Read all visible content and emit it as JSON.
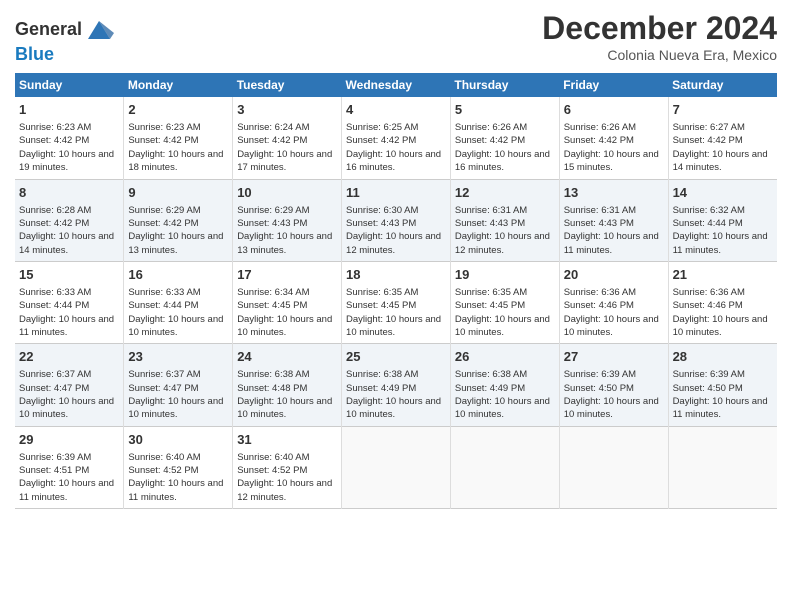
{
  "header": {
    "logo_line1": "General",
    "logo_line2": "Blue",
    "month": "December 2024",
    "location": "Colonia Nueva Era, Mexico"
  },
  "weekdays": [
    "Sunday",
    "Monday",
    "Tuesday",
    "Wednesday",
    "Thursday",
    "Friday",
    "Saturday"
  ],
  "weeks": [
    [
      {
        "day": "1",
        "sunrise": "6:23 AM",
        "sunset": "4:42 PM",
        "daylight": "10 hours and 19 minutes."
      },
      {
        "day": "2",
        "sunrise": "6:23 AM",
        "sunset": "4:42 PM",
        "daylight": "10 hours and 18 minutes."
      },
      {
        "day": "3",
        "sunrise": "6:24 AM",
        "sunset": "4:42 PM",
        "daylight": "10 hours and 17 minutes."
      },
      {
        "day": "4",
        "sunrise": "6:25 AM",
        "sunset": "4:42 PM",
        "daylight": "10 hours and 16 minutes."
      },
      {
        "day": "5",
        "sunrise": "6:26 AM",
        "sunset": "4:42 PM",
        "daylight": "10 hours and 16 minutes."
      },
      {
        "day": "6",
        "sunrise": "6:26 AM",
        "sunset": "4:42 PM",
        "daylight": "10 hours and 15 minutes."
      },
      {
        "day": "7",
        "sunrise": "6:27 AM",
        "sunset": "4:42 PM",
        "daylight": "10 hours and 14 minutes."
      }
    ],
    [
      {
        "day": "8",
        "sunrise": "6:28 AM",
        "sunset": "4:42 PM",
        "daylight": "10 hours and 14 minutes."
      },
      {
        "day": "9",
        "sunrise": "6:29 AM",
        "sunset": "4:42 PM",
        "daylight": "10 hours and 13 minutes."
      },
      {
        "day": "10",
        "sunrise": "6:29 AM",
        "sunset": "4:43 PM",
        "daylight": "10 hours and 13 minutes."
      },
      {
        "day": "11",
        "sunrise": "6:30 AM",
        "sunset": "4:43 PM",
        "daylight": "10 hours and 12 minutes."
      },
      {
        "day": "12",
        "sunrise": "6:31 AM",
        "sunset": "4:43 PM",
        "daylight": "10 hours and 12 minutes."
      },
      {
        "day": "13",
        "sunrise": "6:31 AM",
        "sunset": "4:43 PM",
        "daylight": "10 hours and 11 minutes."
      },
      {
        "day": "14",
        "sunrise": "6:32 AM",
        "sunset": "4:44 PM",
        "daylight": "10 hours and 11 minutes."
      }
    ],
    [
      {
        "day": "15",
        "sunrise": "6:33 AM",
        "sunset": "4:44 PM",
        "daylight": "10 hours and 11 minutes."
      },
      {
        "day": "16",
        "sunrise": "6:33 AM",
        "sunset": "4:44 PM",
        "daylight": "10 hours and 10 minutes."
      },
      {
        "day": "17",
        "sunrise": "6:34 AM",
        "sunset": "4:45 PM",
        "daylight": "10 hours and 10 minutes."
      },
      {
        "day": "18",
        "sunrise": "6:35 AM",
        "sunset": "4:45 PM",
        "daylight": "10 hours and 10 minutes."
      },
      {
        "day": "19",
        "sunrise": "6:35 AM",
        "sunset": "4:45 PM",
        "daylight": "10 hours and 10 minutes."
      },
      {
        "day": "20",
        "sunrise": "6:36 AM",
        "sunset": "4:46 PM",
        "daylight": "10 hours and 10 minutes."
      },
      {
        "day": "21",
        "sunrise": "6:36 AM",
        "sunset": "4:46 PM",
        "daylight": "10 hours and 10 minutes."
      }
    ],
    [
      {
        "day": "22",
        "sunrise": "6:37 AM",
        "sunset": "4:47 PM",
        "daylight": "10 hours and 10 minutes."
      },
      {
        "day": "23",
        "sunrise": "6:37 AM",
        "sunset": "4:47 PM",
        "daylight": "10 hours and 10 minutes."
      },
      {
        "day": "24",
        "sunrise": "6:38 AM",
        "sunset": "4:48 PM",
        "daylight": "10 hours and 10 minutes."
      },
      {
        "day": "25",
        "sunrise": "6:38 AM",
        "sunset": "4:49 PM",
        "daylight": "10 hours and 10 minutes."
      },
      {
        "day": "26",
        "sunrise": "6:38 AM",
        "sunset": "4:49 PM",
        "daylight": "10 hours and 10 minutes."
      },
      {
        "day": "27",
        "sunrise": "6:39 AM",
        "sunset": "4:50 PM",
        "daylight": "10 hours and 10 minutes."
      },
      {
        "day": "28",
        "sunrise": "6:39 AM",
        "sunset": "4:50 PM",
        "daylight": "10 hours and 11 minutes."
      }
    ],
    [
      {
        "day": "29",
        "sunrise": "6:39 AM",
        "sunset": "4:51 PM",
        "daylight": "10 hours and 11 minutes."
      },
      {
        "day": "30",
        "sunrise": "6:40 AM",
        "sunset": "4:52 PM",
        "daylight": "10 hours and 11 minutes."
      },
      {
        "day": "31",
        "sunrise": "6:40 AM",
        "sunset": "4:52 PM",
        "daylight": "10 hours and 12 minutes."
      },
      null,
      null,
      null,
      null
    ]
  ]
}
